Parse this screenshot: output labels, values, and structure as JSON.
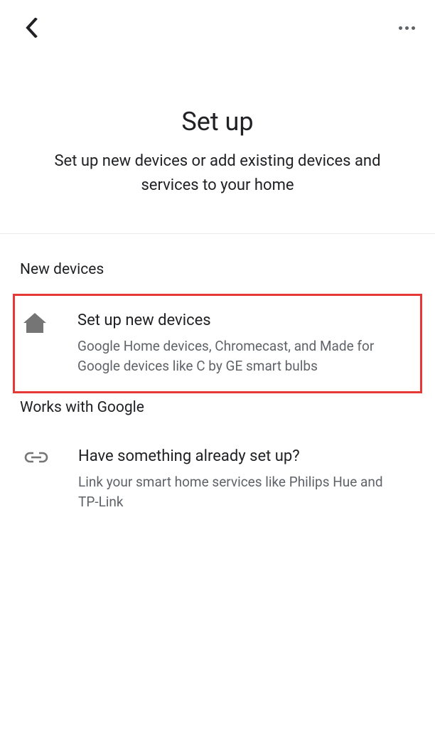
{
  "header": {
    "title": "Set up",
    "subtitle": "Set up new devices or add existing devices and services to your home"
  },
  "sections": {
    "new_devices": {
      "label": "New devices",
      "option": {
        "title": "Set up new devices",
        "desc": "Google Home devices, Chromecast, and Made for Google devices like C by GE smart bulbs"
      }
    },
    "works_with": {
      "label": "Works with Google",
      "option": {
        "title": "Have something already set up?",
        "desc": "Link your smart home services like Philips Hue and TP-Link"
      }
    }
  }
}
